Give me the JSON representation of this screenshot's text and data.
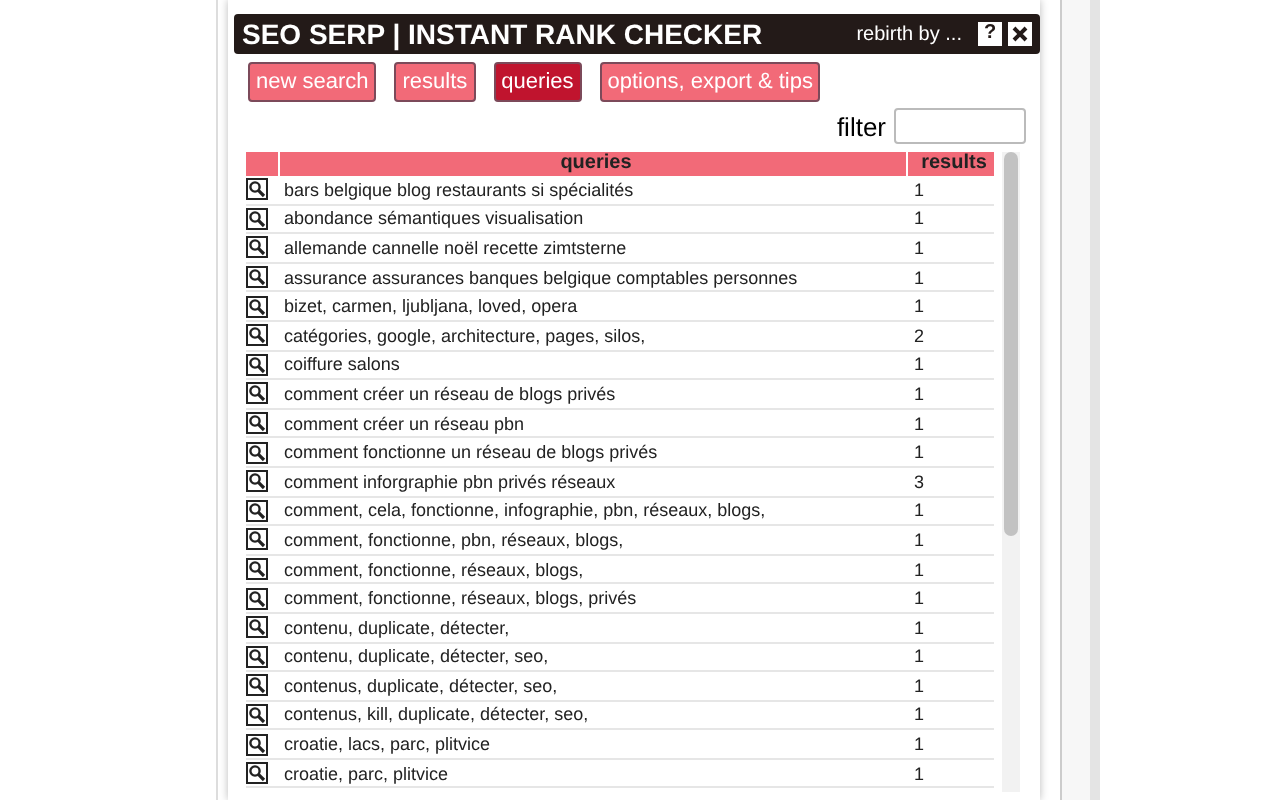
{
  "window": {
    "title": "SEO SERP | INSTANT RANK CHECKER",
    "byline": "rebirth by ...",
    "help": "?"
  },
  "tabs": [
    {
      "label": "new search",
      "selected": false
    },
    {
      "label": "results",
      "selected": false
    },
    {
      "label": "queries",
      "selected": true
    },
    {
      "label": "options, export & tips",
      "selected": false
    }
  ],
  "filter": {
    "label": "filter"
  },
  "table": {
    "columns": [
      "queries",
      "results"
    ],
    "rows": [
      [
        "bars belgique blog restaurants si spécialités",
        "1"
      ],
      [
        "abondance sémantiques visualisation",
        "1"
      ],
      [
        "allemande cannelle noël recette zimtsterne",
        "1"
      ],
      [
        "assurance assurances banques belgique comptables personnes",
        "1"
      ],
      [
        "bizet, carmen, ljubljana, loved, opera",
        "1"
      ],
      [
        "catégories, google, architecture, pages, silos,",
        "2"
      ],
      [
        "coiffure salons",
        "1"
      ],
      [
        "comment créer un réseau de blogs privés",
        "1"
      ],
      [
        "comment créer un réseau pbn",
        "1"
      ],
      [
        "comment fonctionne un réseau de blogs privés",
        "1"
      ],
      [
        "comment inforgraphie pbn privés réseaux",
        "3"
      ],
      [
        "comment, cela, fonctionne, infographie, pbn, réseaux, blogs,",
        "1"
      ],
      [
        "comment, fonctionne, pbn, réseaux, blogs,",
        "1"
      ],
      [
        "comment, fonctionne, réseaux, blogs,",
        "1"
      ],
      [
        "comment, fonctionne, réseaux, blogs, privés",
        "1"
      ],
      [
        "contenu, duplicate, détecter,",
        "1"
      ],
      [
        "contenu, duplicate, détecter, seo,",
        "1"
      ],
      [
        "contenus, duplicate, détecter, seo,",
        "1"
      ],
      [
        "contenus, kill, duplicate, détecter, seo,",
        "1"
      ],
      [
        "croatie, lacs, parc, plitvice",
        "1"
      ],
      [
        "croatie, parc, plitvice",
        "1"
      ]
    ]
  }
}
